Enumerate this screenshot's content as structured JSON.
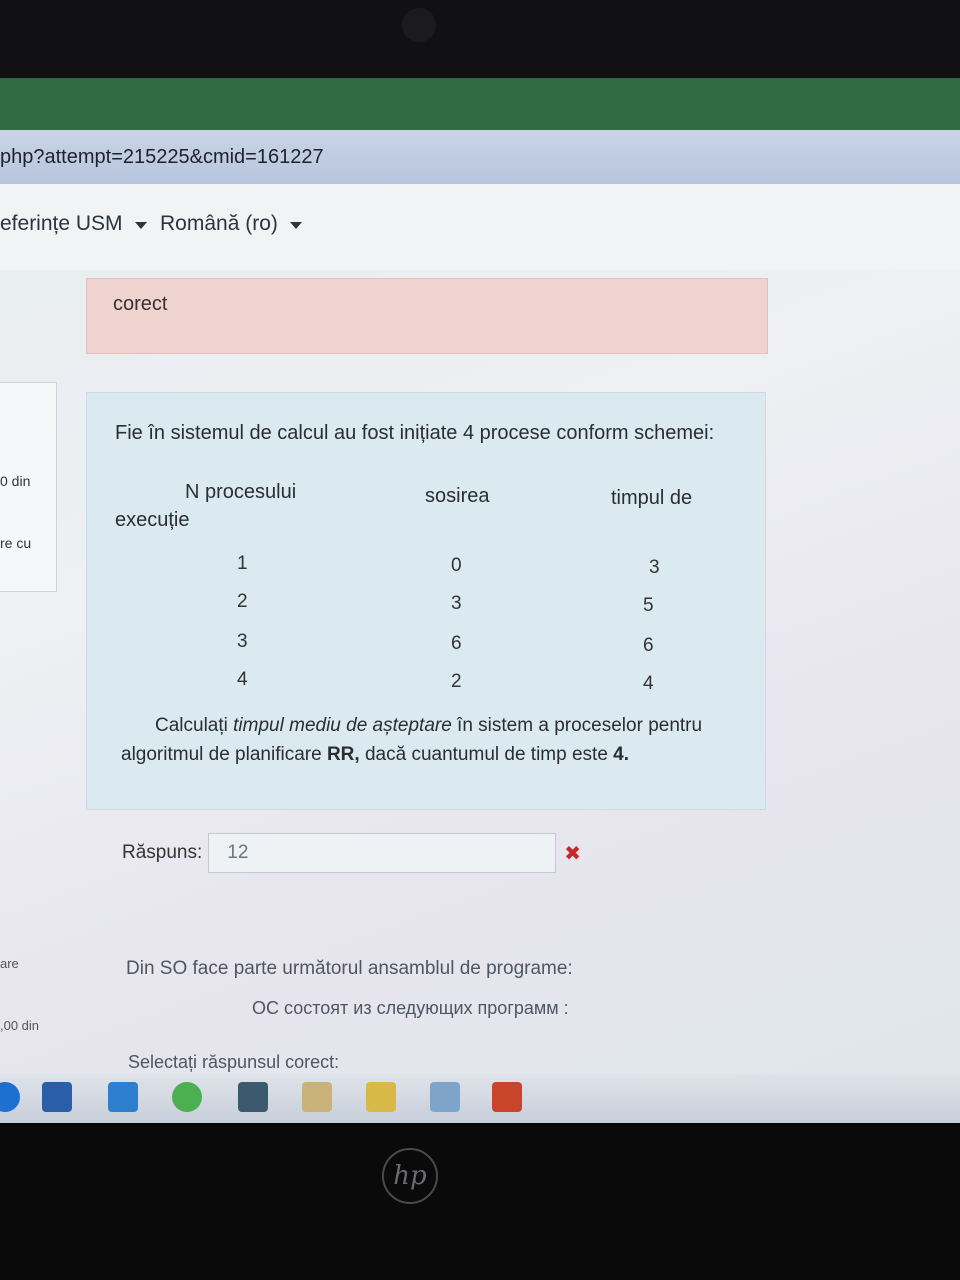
{
  "browser": {
    "url_fragment": "php?attempt=215225&cmid=161227"
  },
  "navbar": {
    "preferences_label": "eferințe USM",
    "language_label": "Română (ro)"
  },
  "sidebar": {
    "frag1": "0 din",
    "frag2": "re cu",
    "frag3": "are",
    "frag4": ",00 din"
  },
  "feedback": {
    "text": "corect"
  },
  "question": {
    "intro": "Fie în sistemul de calcul au fost inițiate  4 procese conform schemei:",
    "headers": {
      "process": "N procesului",
      "arrival": "sosirea",
      "exec_a": "timpul de",
      "exec_b": "execuție"
    },
    "rows": [
      {
        "n": "1",
        "arrival": "0",
        "time": "3"
      },
      {
        "n": "2",
        "arrival": "3",
        "time": "5"
      },
      {
        "n": "3",
        "arrival": "6",
        "time": "6"
      },
      {
        "n": "4",
        "arrival": "2",
        "time": "4"
      }
    ],
    "calc": {
      "p1": "Calculați ",
      "em": "timpul mediu de așteptare",
      "p2": " în sistem a proceselor pentru algoritmul de planificare ",
      "bold1": "RR,",
      "p3": " dacă cuantumul de timp este ",
      "bold2": "4."
    }
  },
  "answer": {
    "label": "Răspuns:",
    "value": "12",
    "status_icon": "✖"
  },
  "next_question": {
    "line1": "Din SO face parte următorul ansamblul de programe:",
    "line2": "ОС состоят из следующих программ :",
    "line3": "Selectați răspunsul corect:"
  },
  "taskbar": {
    "icons": [
      "edge-icon",
      "store-icon",
      "mail-icon",
      "chrome-icon",
      "app-icon",
      "notepad-icon",
      "explorer-icon",
      "folder-icon",
      "powerpoint-icon"
    ]
  },
  "colors": {
    "feedback_bg": "#efd3cf",
    "question_bg": "#dbe9f0",
    "wrong": "#c62828"
  }
}
